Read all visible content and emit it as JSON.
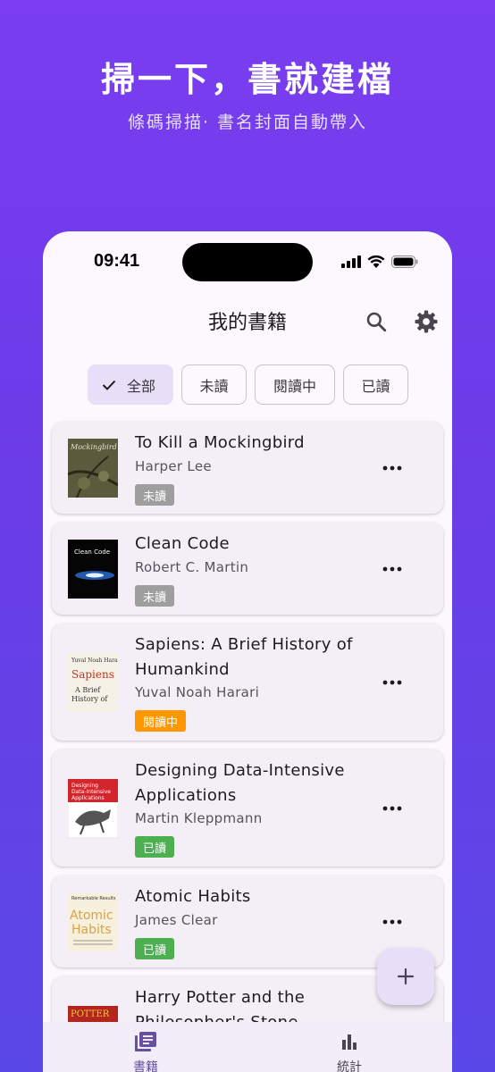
{
  "hero": {
    "title": "掃一下，書就建檔",
    "subtitle": "條碼掃描· 書名封面自動帶入"
  },
  "status_bar": {
    "time": "09:41"
  },
  "app_bar": {
    "title": "我的書籍",
    "actions": [
      "search-icon",
      "gear-icon"
    ]
  },
  "filters": {
    "selected": "全部",
    "items": [
      {
        "label": "全部"
      },
      {
        "label": "未讀"
      },
      {
        "label": "閱讀中"
      },
      {
        "label": "已讀"
      }
    ]
  },
  "books": [
    {
      "title": "To Kill a Mockingbird",
      "author": "Harper Lee",
      "status": "未讀",
      "status_color": "#9e9e9e",
      "cover_text": "Mockingbird"
    },
    {
      "title": "Clean Code",
      "author": "Robert C. Martin",
      "status": "未讀",
      "status_color": "#9e9e9e",
      "cover_text": "Clean Code"
    },
    {
      "title": "Sapiens: A Brief History of Humankind",
      "author": "Yuval Noah Harari",
      "status": "閱讀中",
      "status_color": "#ff9800",
      "cover_text": "Yuval Noah Harari Sapiens A Brief History of"
    },
    {
      "title": "Designing Data-Intensive Applications",
      "author": "Martin Kleppmann",
      "status": "已讀",
      "status_color": "#4caf50",
      "cover_text": "Designing Data-Intensive Applications"
    },
    {
      "title": "Atomic Habits",
      "author": "James Clear",
      "status": "已讀",
      "status_color": "#4caf50",
      "cover_text": "Atomic Habits"
    },
    {
      "title": "Harry Potter and the Philosopher's Stone",
      "author": "",
      "status": "",
      "status_color": "",
      "cover_text": "POTTER"
    }
  ],
  "fab": {
    "icon": "plus-icon"
  },
  "bottom_nav": {
    "items": [
      {
        "label": "書籍",
        "icon": "library-icon",
        "active": true
      },
      {
        "label": "統計",
        "icon": "bar-chart-icon",
        "active": false
      }
    ]
  },
  "colors": {
    "accent": "#6750a4",
    "background_top": "#7a3df0",
    "surface": "#fcf8fd",
    "chip_selected": "#e8def8"
  }
}
